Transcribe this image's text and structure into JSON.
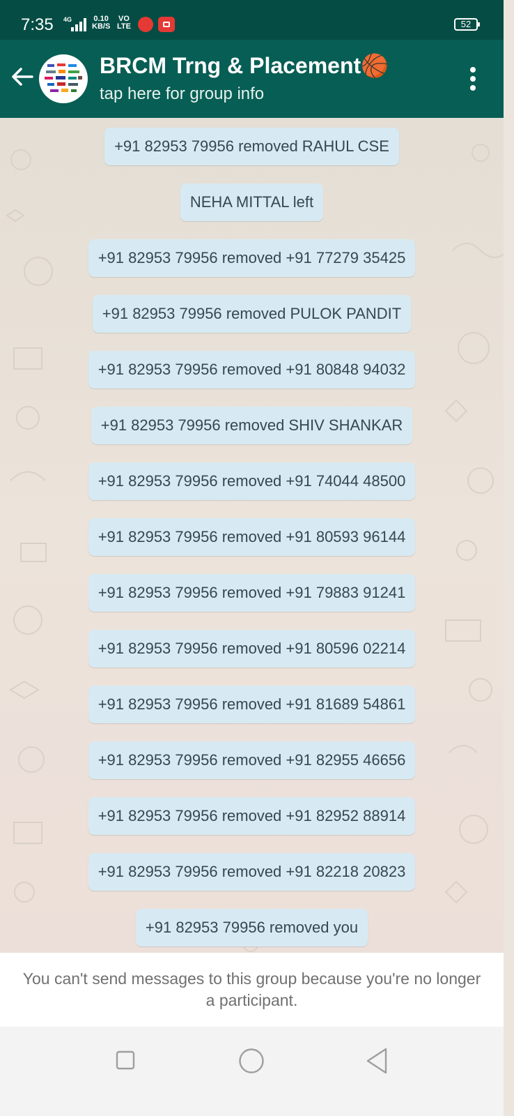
{
  "status_bar": {
    "time": "7:35",
    "network": "4G",
    "speed_value": "0.10",
    "speed_unit": "KB/S",
    "volte_top": "VO",
    "volte_bottom": "LTE",
    "battery": "52"
  },
  "header": {
    "title": "BRCM Trng & Placement🏀",
    "subtitle": "tap here for group info",
    "back_icon": "arrow-left-icon",
    "menu_icon": "more-vert-icon"
  },
  "messages": [
    "+91 82953 79956 removed RAHUL CSE",
    "NEHA MITTAL left",
    "+91 82953 79956 removed +91 77279 35425",
    "+91 82953 79956 removed PULOK PANDIT",
    "+91 82953 79956 removed +91 80848 94032",
    "+91 82953 79956 removed SHIV SHANKAR",
    "+91 82953 79956 removed +91 74044 48500",
    "+91 82953 79956 removed +91 80593 96144",
    "+91 82953 79956 removed +91 79883 91241",
    "+91 82953 79956 removed +91 80596 02214",
    "+91 82953 79956 removed +91 81689 54861",
    "+91 82953 79956 removed +91 82955 46656",
    "+91 82953 79956 removed +91 82952 88914",
    "+91 82953 79956 removed +91 82218 20823",
    "+91 82953 79956 removed you"
  ],
  "footer": {
    "notice": "You can't send messages to this group because you're no longer a participant."
  },
  "colors": {
    "header": "#075e54",
    "status_bar": "#054d44",
    "system_bubble": "#d7eaf3",
    "system_text": "#37474f"
  }
}
